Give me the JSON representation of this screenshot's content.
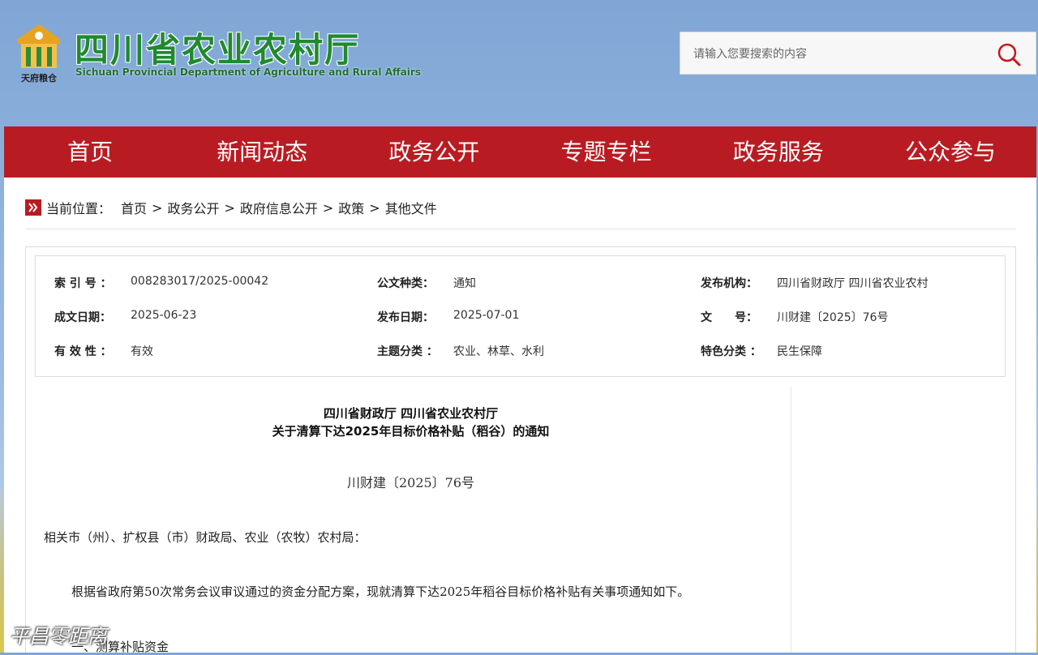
{
  "header": {
    "logo_emblem_caption": "天府粮仓",
    "logo_title": "四川省农业农村厅",
    "logo_subtitle": "Sichuan Provincial Department of Agriculture and Rural Affairs",
    "search": {
      "placeholder": "请输入您要搜索的内容",
      "value": ""
    }
  },
  "nav": {
    "items": [
      "首页",
      "新闻动态",
      "政务公开",
      "专题专栏",
      "政务服务",
      "公众参与"
    ]
  },
  "breadcrumb": {
    "label": "当前位置：",
    "items": [
      "首页",
      "政务公开",
      "政府信息公开",
      "政策",
      "其他文件"
    ],
    "separator": ">"
  },
  "meta": {
    "index_label": "索 引 号 ：",
    "index_value": "008283017/2025-00042",
    "doc_type_label": "公文种类：",
    "doc_type_value": "通知",
    "issuer_label": "发布机构：",
    "issuer_value": "四川省财政厅 四川省农业农村",
    "written_date_label": "成文日期：",
    "written_date_value": "2025-06-23",
    "publish_date_label": "发布日期：",
    "publish_date_value": "2025-07-01",
    "doc_no_label": "文　　号：",
    "doc_no_value": "川财建〔2025〕76号",
    "validity_label": "有 效 性 ：",
    "validity_value": "有效",
    "topic_label": "主题分类 ：",
    "topic_value": "农业、林草、水利",
    "feature_label": "特色分类 ：",
    "feature_value": "民生保障"
  },
  "document": {
    "title_line1": "四川省财政厅 四川省农业农村厅",
    "title_line2": "关于清算下达2025年目标价格补贴（稻谷）的通知",
    "number": "川财建〔2025〕76号",
    "addressee": "相关市（州）、扩权县（市）财政局、农业（农牧）农村局：",
    "paragraph1": "根据省政府第50次常务会议审议通过的资金分配方案，现就清算下达2025年稻谷目标价格补贴有关事项通知如下。",
    "section1_heading": "一、测算补贴资金"
  },
  "watermark": "平昌零距离",
  "colors": {
    "nav_red": "#b81c22",
    "logo_green": "#1f8a2e",
    "search_icon_red": "#c8161d"
  }
}
